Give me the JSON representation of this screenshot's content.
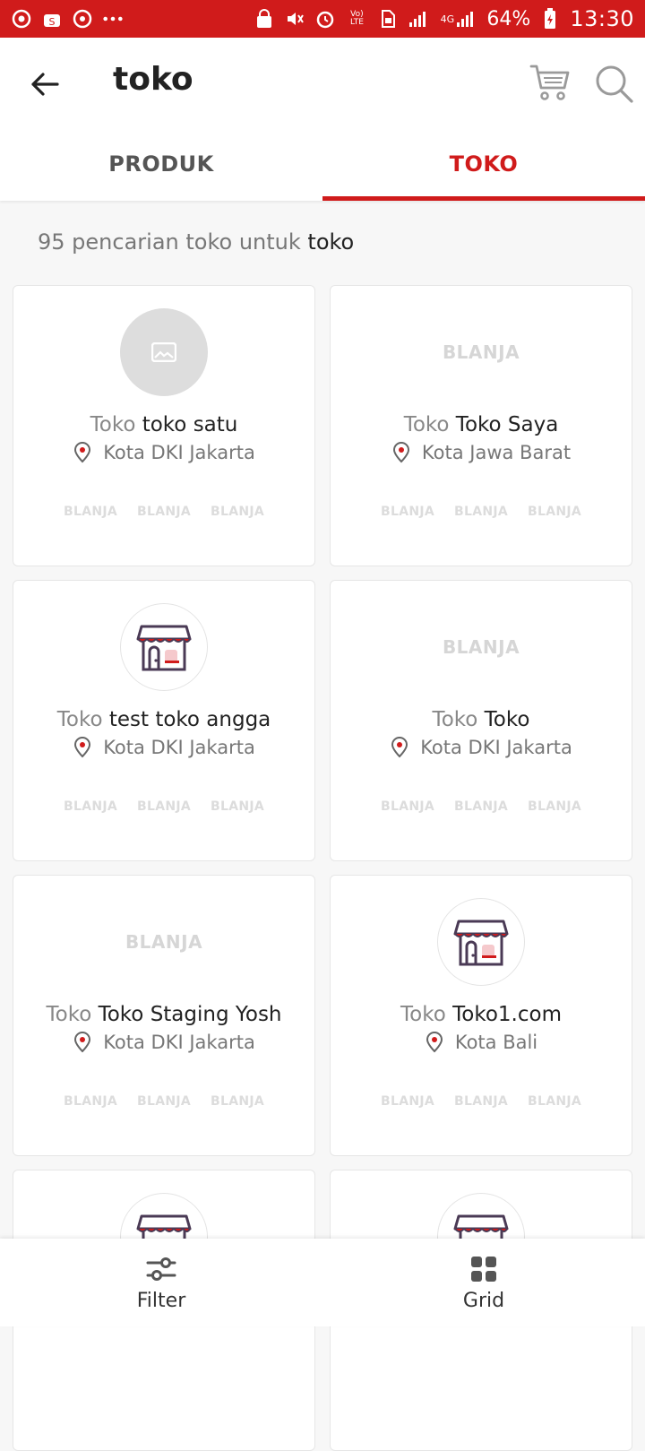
{
  "status_bar": {
    "left_icons": [
      "chrome-icon",
      "shop-icon",
      "sync-icon",
      "more-dots-icon"
    ],
    "right_icons": [
      "lock-icon",
      "mute-icon",
      "alarm-icon",
      "volte-icon",
      "sim-icon",
      "signal-icon",
      "4g-signal-icon",
      "battery-icon"
    ],
    "volte_label": "Vo) LTE",
    "network_label": "4G",
    "battery": "64%",
    "time": "13:30"
  },
  "header": {
    "query": "toko",
    "icons": [
      "back-arrow-icon",
      "cart-icon",
      "search-icon"
    ]
  },
  "tabs": [
    {
      "label": "PRODUK",
      "active": false
    },
    {
      "label": "TOKO",
      "active": true
    }
  ],
  "summary": {
    "count_text": "95 pencarian toko untuk",
    "query": "toko"
  },
  "stores": [
    {
      "prefix": "Toko",
      "name": "toko satu",
      "location": "Kota DKI Jakarta",
      "logo": "placeholder",
      "logo_text": ""
    },
    {
      "prefix": "Toko",
      "name": "Toko Saya",
      "location": "Kota Jawa Barat",
      "logo": "blanja",
      "logo_text": "BLANJA"
    },
    {
      "prefix": "Toko",
      "name": "test toko angga",
      "location": "Kota DKI Jakarta",
      "logo": "store",
      "logo_text": ""
    },
    {
      "prefix": "Toko",
      "name": "Toko",
      "location": "Kota DKI Jakarta",
      "logo": "blanja",
      "logo_text": "BLANJA"
    },
    {
      "prefix": "Toko",
      "name": "Toko Staging Yosh",
      "location": "Kota DKI Jakarta",
      "logo": "blanja",
      "logo_text": "BLANJA"
    },
    {
      "prefix": "Toko",
      "name": "Toko1.com",
      "location": "Kota Bali",
      "logo": "store",
      "logo_text": ""
    }
  ],
  "thumb_label": "BLANJA",
  "bottom_bar": [
    {
      "label": "Filter",
      "icon": "filter-sliders-icon"
    },
    {
      "label": "Grid",
      "icon": "grid-icon"
    }
  ]
}
